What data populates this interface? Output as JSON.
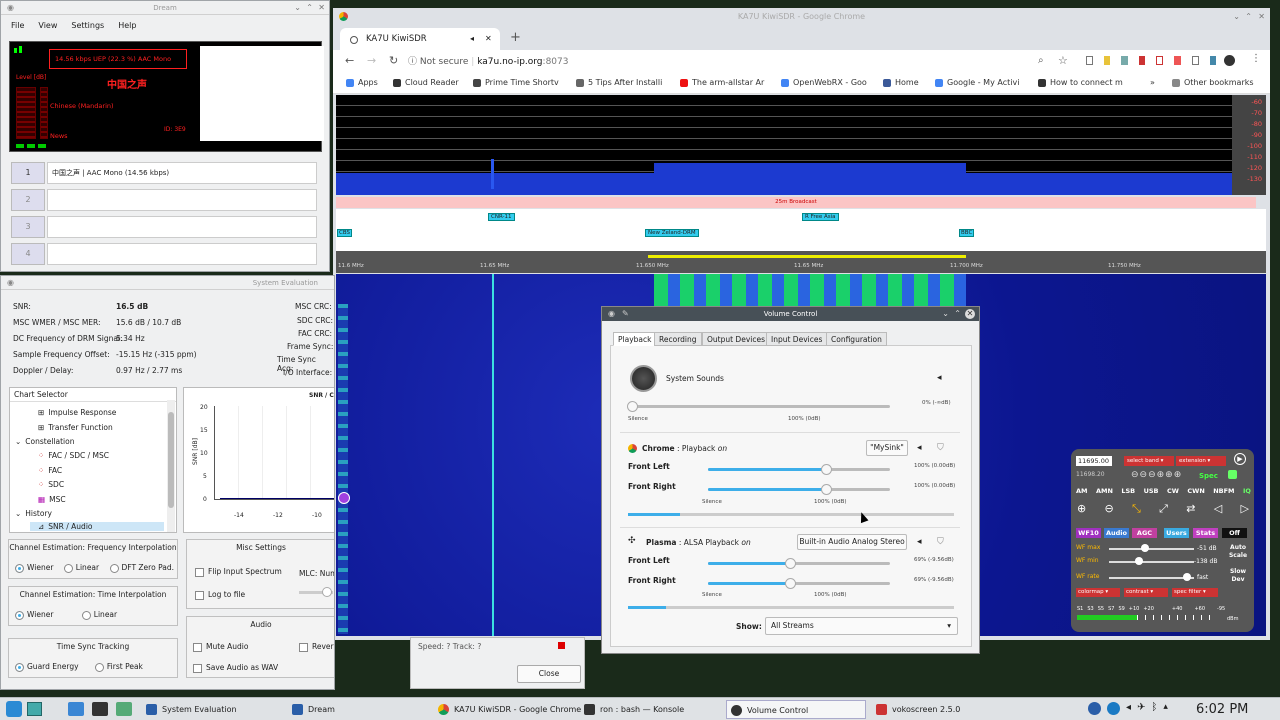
{
  "dream_window": {
    "title": "Dream",
    "menu": [
      "File",
      "View",
      "Settings",
      "Help"
    ],
    "display": {
      "bitrate_text": "14.56 kbps UEP (22.3 %)  AAC  Mono",
      "station_cn": "中国之声",
      "language": "Chinese (Mandarin)",
      "program_type": "News",
      "id": "ID: 3E9",
      "level_label": "Level [dB]"
    },
    "services": [
      {
        "num": "1",
        "label": "中国之声  |  AAC Mono (14.56 kbps)"
      },
      {
        "num": "2",
        "label": ""
      },
      {
        "num": "3",
        "label": ""
      },
      {
        "num": "4",
        "label": ""
      }
    ]
  },
  "sys_eval": {
    "title": "System Evaluation",
    "left_values": [
      {
        "label": "SNR:",
        "value": "16.5 dB"
      },
      {
        "label": "MSC WMER / MSC MER:",
        "value": "15.6 dB / 10.7 dB"
      },
      {
        "label": "DC Frequency of DRM Signal:",
        "value": "5.34 Hz"
      },
      {
        "label": "Sample Frequency Offset:",
        "value": "-15.15 Hz (-315 ppm)"
      },
      {
        "label": "Doppler / Delay:",
        "value": "0.97 Hz / 2.77 ms"
      }
    ],
    "right_labels": [
      "MSC CRC:",
      "SDC CRC:",
      "FAC CRC:",
      "Frame Sync:",
      "Time Sync Acq:",
      "I/O Interface:"
    ],
    "chart_selector_title": "Chart Selector",
    "tree": [
      "Impulse Response",
      "Transfer Function",
      "Constellation",
      "FAC / SDC / MSC",
      "FAC",
      "SDC",
      "MSC",
      "History",
      "SNR / Audio"
    ],
    "chart_title": "SNR / C",
    "chart_ylabel": "SNR [dB]",
    "chart_yticks": [
      "20",
      "15",
      "10",
      "5",
      "0"
    ],
    "chart_xticks": [
      "-14",
      "-12",
      "-10"
    ],
    "freq_interp_title": "Channel Estimation: Frequency Interpolation",
    "freq_interp_options": [
      "Wiener",
      "Linear",
      "DFT Zero Pad."
    ],
    "time_interp_title": "Channel Estimation: Time Interpolation",
    "time_interp_options": [
      "Wiener",
      "Linear"
    ],
    "time_sync_title": "Time Sync Tracking",
    "time_sync_options": [
      "Guard Energy",
      "First Peak"
    ],
    "misc_title": "Misc Settings",
    "misc_options": [
      "Flip Input Spectrum",
      "Log to file"
    ],
    "mlc_label": "MLC: Num",
    "audio_title": "Audio",
    "audio_options": [
      "Mute Audio",
      "Reverberation",
      "Save Audio as WAV"
    ],
    "speed_text": "Speed: ?  Track: ?",
    "close_label": "Close"
  },
  "chrome": {
    "window_title": "KA7U KiwiSDR - Google Chrome",
    "tab_title": "KA7U KiwiSDR",
    "not_secure": "Not secure",
    "url_host": "ka7u.no-ip.org",
    "url_port": ":8073",
    "bookmarks": [
      "Apps",
      "Cloud Reader",
      "Prime Time Shortv",
      "5 Tips After Installi",
      "The arm-allstar Ar",
      "OpenWebRX - Goo",
      "Home",
      "Google - My Activi",
      "How to connect m",
      "Other bookmarks"
    ]
  },
  "kiwi": {
    "db_scale": [
      "-60",
      "-70",
      "-80",
      "-90",
      "-100",
      "-110",
      "-120",
      "-130"
    ],
    "band_label": "25m Broadcast",
    "stations_top": [
      "CNR-11",
      "R Free Asia"
    ],
    "stations_mid": [
      "CBS",
      "New Zeland-DRM",
      "BBC"
    ],
    "freq_ticks": [
      "11.6 MHz",
      "11.65 MHz",
      "11.650 MHz",
      "11.65 MHz",
      "11.700 MHz",
      "11.750 MHz"
    ],
    "freq_input": "11695.00",
    "freq_sub": "11698.20",
    "select_band": "select band",
    "extension": "extension",
    "spec_label": "Spec",
    "modes": [
      "AM",
      "AMN",
      "LSB",
      "USB",
      "CW",
      "CWN",
      "NBFM",
      "IQ"
    ],
    "row_buttons": [
      "WF10",
      "Audio",
      "AGC",
      "Users",
      "Stats",
      "Off"
    ],
    "wf_max_label": "WF max",
    "wf_max_value": "-51 dB",
    "wf_min_label": "WF min",
    "wf_min_value": "-138 dB",
    "wf_rate_label": "WF rate",
    "wf_rate_value": "fast",
    "auto_scale": "Auto Scale",
    "slow_dev": "Slow Dev",
    "dropdowns": [
      "colormap",
      "contrast",
      "spec filter"
    ],
    "smeter_labels": [
      "S1",
      "S3",
      "S5",
      "S7",
      "S9",
      "+10",
      "+20",
      "+40",
      "+60",
      "-95",
      "dBm"
    ]
  },
  "volume": {
    "title": "Volume Control",
    "tabs": [
      "Playback",
      "Recording",
      "Output Devices",
      "Input Devices",
      "Configuration"
    ],
    "system_sounds": "System Sounds",
    "ss_value": "0% (-∞dB)",
    "silence": "Silence",
    "hundred": "100% (0dB)",
    "chrome_app": "Chrome",
    "chrome_sub": "Playback",
    "chrome_on": "on",
    "chrome_sink": "\"MySink\"",
    "front_left": "Front Left",
    "front_right": "Front Right",
    "chrome_fl_value": "100% (0.00dB)",
    "chrome_fr_value": "100% (0.00dB)",
    "plasma_app": "Plasma",
    "plasma_sub": "ALSA Playback",
    "plasma_on": "on",
    "plasma_sink": "Built-in Audio Analog Stereo",
    "plasma_fl_value": "69% (-9.56dB)",
    "plasma_fr_value": "69% (-9.56dB)",
    "show_label": "Show:",
    "show_value": "All Streams",
    "chrome_level": 1.0,
    "plasma_level": 0.69,
    "system_level": 0.0
  },
  "taskbar": {
    "tasks": [
      "System Evaluation",
      "Dream",
      "KA7U KiwiSDR - Google Chrome",
      "ron : bash — Konsole",
      "Volume Control",
      "vokoscreen 2.5.0"
    ],
    "clock": "6:02 PM"
  },
  "colors": {
    "accent": "#3daee9",
    "kiwi_blue": "#1a2fb0",
    "red_text": "#ff2020"
  }
}
